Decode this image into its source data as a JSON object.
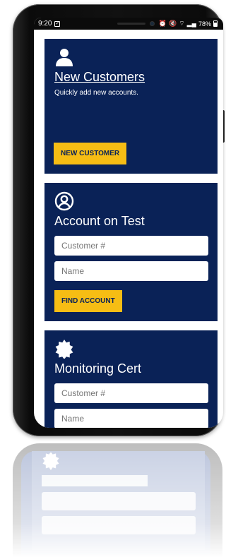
{
  "status_bar": {
    "time": "9:20",
    "battery": "78%"
  },
  "cards": {
    "new_customers": {
      "icon": "person-icon",
      "title": "New Customers",
      "subtitle": "Quickly add new accounts.",
      "button": "NEW CUSTOMER"
    },
    "account_on_test": {
      "icon": "user-circle-icon",
      "title": "Account on Test",
      "customer_placeholder": "Customer #",
      "name_placeholder": "Name",
      "button": "FIND ACCOUNT"
    },
    "monitoring_cert": {
      "icon": "badge-icon",
      "title": "Monitoring Cert",
      "customer_placeholder": "Customer #",
      "name_placeholder": "Name"
    }
  },
  "colors": {
    "card_bg": "#0a2257",
    "button_bg": "#f6bd14",
    "phone_frame": "#111111"
  }
}
